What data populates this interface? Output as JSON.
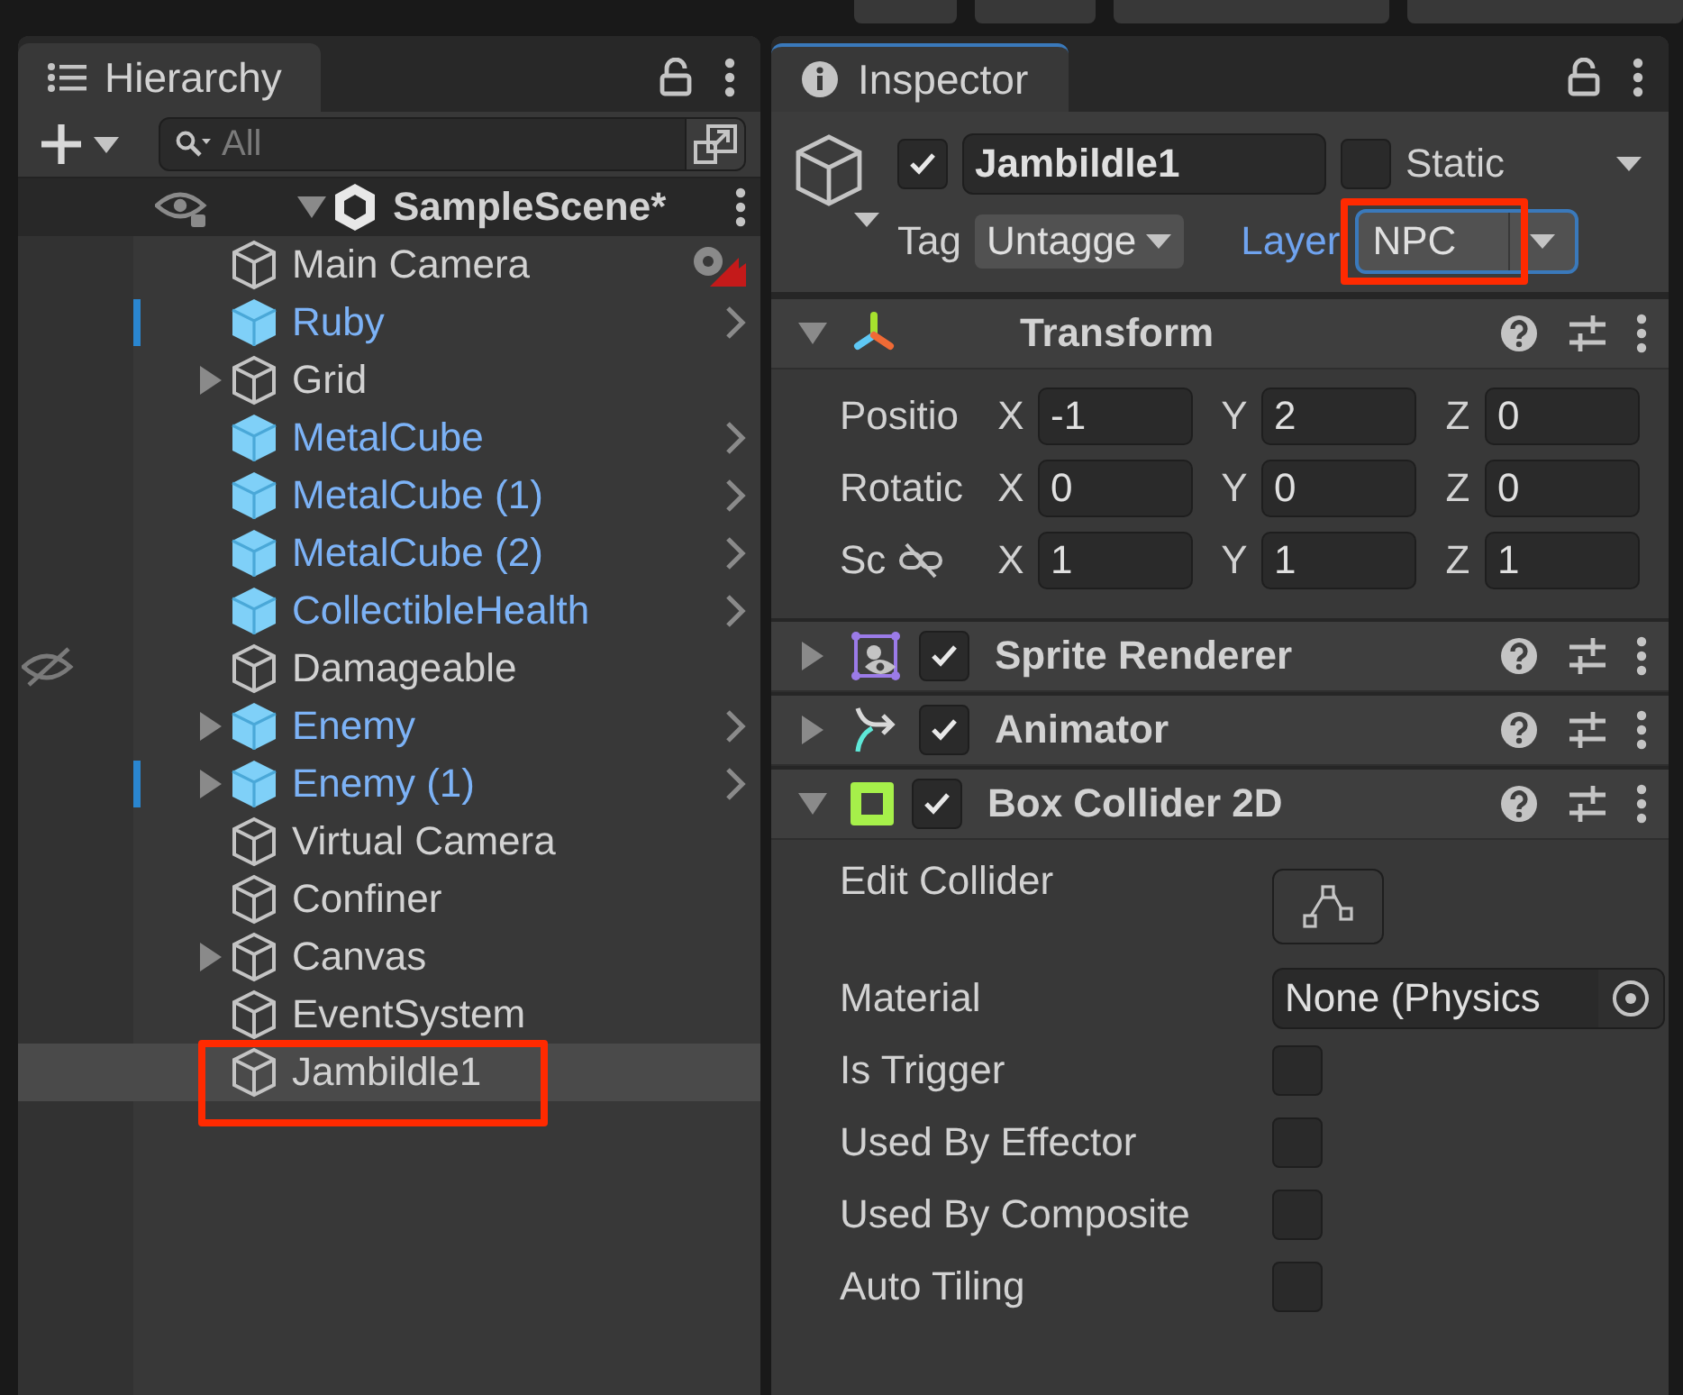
{
  "hierarchy": {
    "title": "Hierarchy",
    "search": {
      "placeholder": "All"
    },
    "scene": {
      "name": "SampleScene*",
      "expanded": true
    },
    "items": [
      {
        "name": "Main Camera",
        "kind": "object",
        "expandable": false,
        "modified": false,
        "hidden": false,
        "gizmo": true,
        "selected": false,
        "highlighted": false
      },
      {
        "name": "Ruby",
        "kind": "prefab",
        "expandable": false,
        "modified": true,
        "hidden": false,
        "gizmo": false,
        "selected": false,
        "highlighted": false
      },
      {
        "name": "Grid",
        "kind": "object",
        "expandable": true,
        "modified": false,
        "hidden": false,
        "gizmo": false,
        "selected": false,
        "highlighted": false
      },
      {
        "name": "MetalCube",
        "kind": "prefab",
        "expandable": false,
        "modified": false,
        "hidden": false,
        "gizmo": false,
        "selected": false,
        "highlighted": false
      },
      {
        "name": "MetalCube (1)",
        "kind": "prefab",
        "expandable": false,
        "modified": false,
        "hidden": false,
        "gizmo": false,
        "selected": false,
        "highlighted": false
      },
      {
        "name": "MetalCube (2)",
        "kind": "prefab",
        "expandable": false,
        "modified": false,
        "hidden": false,
        "gizmo": false,
        "selected": false,
        "highlighted": false
      },
      {
        "name": "CollectibleHealth",
        "kind": "prefab",
        "expandable": false,
        "modified": false,
        "hidden": false,
        "gizmo": false,
        "selected": false,
        "highlighted": false
      },
      {
        "name": "Damageable",
        "kind": "object",
        "expandable": false,
        "modified": false,
        "hidden": true,
        "gizmo": false,
        "selected": false,
        "highlighted": false
      },
      {
        "name": "Enemy",
        "kind": "prefab",
        "expandable": true,
        "modified": false,
        "hidden": false,
        "gizmo": false,
        "selected": false,
        "highlighted": false
      },
      {
        "name": "Enemy (1)",
        "kind": "prefab",
        "expandable": true,
        "modified": true,
        "hidden": false,
        "gizmo": false,
        "selected": false,
        "highlighted": false
      },
      {
        "name": "Virtual Camera",
        "kind": "object",
        "expandable": false,
        "modified": false,
        "hidden": false,
        "gizmo": false,
        "selected": false,
        "highlighted": false
      },
      {
        "name": "Confiner",
        "kind": "object",
        "expandable": false,
        "modified": false,
        "hidden": false,
        "gizmo": false,
        "selected": false,
        "highlighted": false
      },
      {
        "name": "Canvas",
        "kind": "object",
        "expandable": true,
        "modified": false,
        "hidden": false,
        "gizmo": false,
        "selected": false,
        "highlighted": false
      },
      {
        "name": "EventSystem",
        "kind": "object",
        "expandable": false,
        "modified": false,
        "hidden": false,
        "gizmo": false,
        "selected": false,
        "highlighted": false
      },
      {
        "name": "Jambildle1",
        "kind": "object",
        "expandable": false,
        "modified": false,
        "hidden": false,
        "gizmo": false,
        "selected": true,
        "highlighted": true
      }
    ]
  },
  "inspector": {
    "title": "Inspector",
    "object": {
      "active": true,
      "name": "Jambildle1",
      "static_label": "Static",
      "static": false,
      "tag_label": "Tag",
      "tag": "Untagge",
      "layer_label": "Layer",
      "layer": "NPC",
      "layer_highlighted": true
    },
    "transform": {
      "name": "Transform",
      "expanded": true,
      "rows": [
        {
          "label": "Positio",
          "link": false,
          "fields": [
            {
              "axis": "X",
              "value": "-1"
            },
            {
              "axis": "Y",
              "value": "2"
            },
            {
              "axis": "Z",
              "value": "0"
            }
          ]
        },
        {
          "label": "Rotatic",
          "link": false,
          "fields": [
            {
              "axis": "X",
              "value": "0"
            },
            {
              "axis": "Y",
              "value": "0"
            },
            {
              "axis": "Z",
              "value": "0"
            }
          ]
        },
        {
          "label": "Sc",
          "link": true,
          "fields": [
            {
              "axis": "X",
              "value": "1"
            },
            {
              "axis": "Y",
              "value": "1"
            },
            {
              "axis": "Z",
              "value": "1"
            }
          ]
        }
      ]
    },
    "components": [
      {
        "name": "Sprite Renderer",
        "kind": "sprite",
        "expanded": false,
        "enabled": true
      },
      {
        "name": "Animator",
        "kind": "animator",
        "expanded": false,
        "enabled": true
      },
      {
        "name": "Box Collider 2D",
        "kind": "collider",
        "expanded": true,
        "enabled": true
      }
    ],
    "properties": [
      {
        "label": "Edit Collider",
        "kind": "button"
      },
      {
        "label": "Material",
        "kind": "object",
        "value": "None (Physics"
      },
      {
        "label": "Is Trigger",
        "kind": "checkbox",
        "checked": false
      },
      {
        "label": "Used By Effector",
        "kind": "checkbox",
        "checked": false
      },
      {
        "label": "Used By Composite",
        "kind": "checkbox",
        "checked": false
      },
      {
        "label": "Auto Tiling",
        "kind": "checkbox",
        "checked": false
      }
    ]
  }
}
